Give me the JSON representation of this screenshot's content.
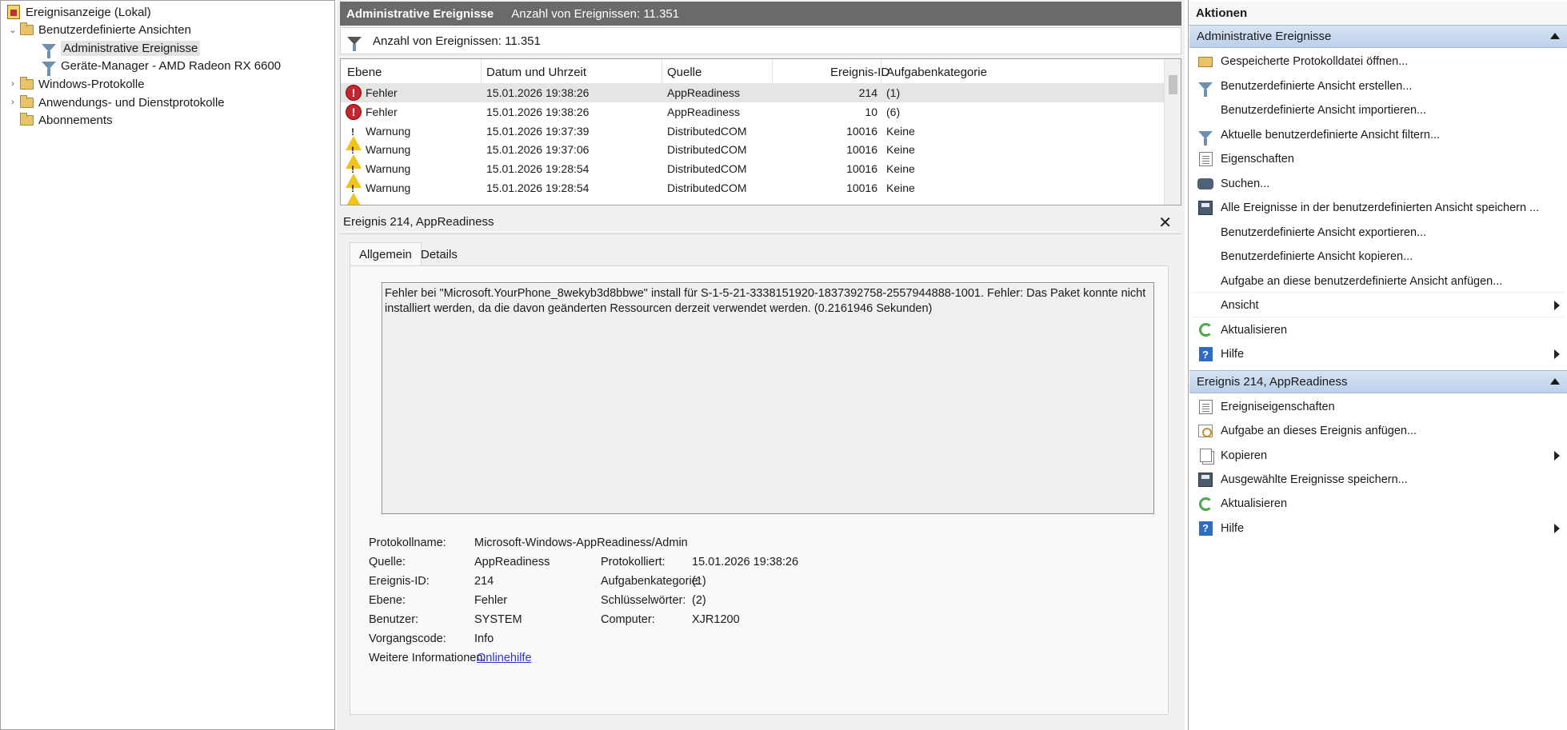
{
  "tree": {
    "root_label": "Ereignisanzeige (Lokal)",
    "custom_views_label": "Benutzerdefinierte Ansichten",
    "admin_events_label": "Administrative Ereignisse",
    "device_manager_label": "Geräte-Manager - AMD Radeon RX 6600",
    "windows_logs_label": "Windows-Protokolle",
    "app_service_logs_label": "Anwendungs- und Dienstprotokolle",
    "subscriptions_label": "Abonnements"
  },
  "middle": {
    "header_title": "Administrative Ereignisse",
    "header_count": "Anzahl von Ereignissen: 11.351",
    "filter_count": "Anzahl von Ereignissen: 11.351"
  },
  "grid": {
    "columns": {
      "level": "Ebene",
      "datetime": "Datum und Uhrzeit",
      "source": "Quelle",
      "event_id": "Ereignis-ID",
      "task_category": "Aufgabenkategorie"
    },
    "rows": [
      {
        "level": "Fehler",
        "type": "error",
        "datetime": "15.01.2026 19:38:26",
        "source": "AppReadiness",
        "event_id": "214",
        "task_category": "(1)"
      },
      {
        "level": "Fehler",
        "type": "error",
        "datetime": "15.01.2026 19:38:26",
        "source": "AppReadiness",
        "event_id": "10",
        "task_category": "(6)"
      },
      {
        "level": "Warnung",
        "type": "warning",
        "datetime": "15.01.2026 19:37:39",
        "source": "DistributedCOM",
        "event_id": "10016",
        "task_category": "Keine"
      },
      {
        "level": "Warnung",
        "type": "warning",
        "datetime": "15.01.2026 19:37:06",
        "source": "DistributedCOM",
        "event_id": "10016",
        "task_category": "Keine"
      },
      {
        "level": "Warnung",
        "type": "warning",
        "datetime": "15.01.2026 19:28:54",
        "source": "DistributedCOM",
        "event_id": "10016",
        "task_category": "Keine"
      },
      {
        "level": "Warnung",
        "type": "warning",
        "datetime": "15.01.2026 19:28:54",
        "source": "DistributedCOM",
        "event_id": "10016",
        "task_category": "Keine"
      }
    ]
  },
  "detail": {
    "title": "Ereignis 214, AppReadiness",
    "close_glyph": "✕",
    "tab_general": "Allgemein",
    "tab_details": "Details",
    "description": "Fehler bei \"Microsoft.YourPhone_8wekyb3d8bbwe\" install für S-1-5-21-3338151920-1837392758-2557944888-1001. Fehler: Das Paket konnte nicht installiert werden, da die davon geänderten Ressourcen derzeit verwendet werden. (0.2161946 Sekunden)",
    "labels": {
      "log_name": "Protokollname:",
      "source": "Quelle:",
      "logged": "Protokolliert:",
      "event_id": "Ereignis-ID:",
      "task_category": "Aufgabenkategorie:",
      "level": "Ebene:",
      "keywords": "Schlüsselwörter:",
      "user": "Benutzer:",
      "computer": "Computer:",
      "opcode": "Vorgangscode:",
      "more_info": "Weitere Informationen:"
    },
    "values": {
      "log_name": "Microsoft-Windows-AppReadiness/Admin",
      "source": "AppReadiness",
      "logged": "15.01.2026 19:38:26",
      "event_id": "214",
      "task_category": "(1)",
      "level": "Fehler",
      "keywords": "(2)",
      "user": "SYSTEM",
      "computer": "XJR1200",
      "opcode": "Info",
      "more_info_link": "Onlinehilfe"
    }
  },
  "actions": {
    "title": "Aktionen",
    "section1_title": "Administrative Ereignisse",
    "section1_items": [
      "Gespeicherte Protokolldatei öffnen...",
      "Benutzerdefinierte Ansicht erstellen...",
      "Benutzerdefinierte Ansicht importieren...",
      "Aktuelle benutzerdefinierte Ansicht filtern...",
      "Eigenschaften",
      "Suchen...",
      "Alle Ereignisse in der benutzerdefinierten Ansicht speichern ...",
      "Benutzerdefinierte Ansicht exportieren...",
      "Benutzerdefinierte Ansicht kopieren...",
      "Aufgabe an diese benutzerdefinierte Ansicht anfügen...",
      "Ansicht",
      "Aktualisieren",
      "Hilfe"
    ],
    "section2_title": "Ereignis 214, AppReadiness",
    "section2_items": [
      "Ereigniseigenschaften",
      "Aufgabe an dieses Ereignis anfügen...",
      "Kopieren",
      "Ausgewählte Ereignisse speichern...",
      "Aktualisieren",
      "Hilfe"
    ]
  },
  "colors": {
    "header_bg": "#6a6a6a",
    "section_head": "#bcd0ea",
    "error": "#c4262e",
    "warning": "#f2c318",
    "link": "#2d32c9"
  }
}
